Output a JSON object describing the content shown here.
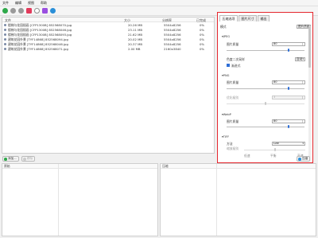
{
  "menu": [
    "文件",
    "编辑",
    "视图",
    "帮助"
  ],
  "toolbar": {
    "icons": [
      "add-icon",
      "remove-icon",
      "clear-icon",
      "delete-icon",
      "search-icon",
      "image-icon",
      "settings-icon"
    ],
    "colors": [
      "#2ea84a",
      "#9a9a9a",
      "#9a9a9a",
      "#e23a5b",
      "#8e8e8e",
      "#9a4fe0",
      "#2a8fd8"
    ]
  },
  "filelist": {
    "headers": {
      "name": "文件",
      "size": "大小",
      "dimensions": "分辨率",
      "progress": "已完成"
    },
    "rows": [
      {
        "name": "楼梯与花园插画 [CFP1300B] 852568070.jpg",
        "size": "20.26 MB",
        "dimensions": "5504x8256",
        "progress": "0%"
      },
      {
        "name": "楼梯与花园插画 [CFP1300B] 852568046.jpg",
        "size": "23.11 MB",
        "dimensions": "5504x8256",
        "progress": "0%"
      },
      {
        "name": "楼梯与花园插画 [CFP1300B] 852568093.jpg",
        "size": "21.62 MB",
        "dimensions": "5504x8256",
        "progress": "0%"
      },
      {
        "name": "建筑花园外景 [TYF14868] 852568094.jpg",
        "size": "20.02 MB",
        "dimensions": "5504x8256",
        "progress": "0%"
      },
      {
        "name": "建筑花园外景 [TYF14868] 852568046.jpg",
        "size": "20.37 MB",
        "dimensions": "5504x8256",
        "progress": "0%"
      },
      {
        "name": "建筑花园外景 [TYF14868] 852568071.jpg",
        "size": "2.00 MB",
        "dimensions": "2160x3840",
        "progress": "0%"
      }
    ]
  },
  "settings": {
    "tabs": [
      "压缩选项",
      "图片尺寸",
      "输出"
    ],
    "mode_label": "模式",
    "mode_value": "图片质量",
    "jpeg": {
      "section": "▾JPEG",
      "quality_label": "图片质量",
      "quality_value": "80",
      "quality_fraction": 0.8,
      "chroma_label": "色度二次采样",
      "chroma_value": "自动",
      "progressive_label": "渐进式",
      "progressive_checked": true
    },
    "png": {
      "section": "▾PNG",
      "quality_label": "图片质量",
      "quality_value": "80",
      "quality_fraction": 0.8,
      "level_label": "优化级别",
      "level_value": "3",
      "level_fraction": 0.5
    },
    "webp": {
      "section": "▾WebP",
      "quality_label": "图片质量",
      "quality_value": "80",
      "quality_fraction": 0.8
    },
    "tiff": {
      "section": "▾TIFF",
      "method_label": "方法",
      "method_value": "Lzw",
      "deflate_label": "缩放级别",
      "deflate_fraction": 0.5,
      "scale": [
        "低速",
        "平衡",
        "高速"
      ]
    }
  },
  "midbar": {
    "add_label": "添加...",
    "remove_label": "移除",
    "compress_label": "压缩"
  },
  "bottom": {
    "left_header": "原始",
    "right_header": "压缩"
  }
}
